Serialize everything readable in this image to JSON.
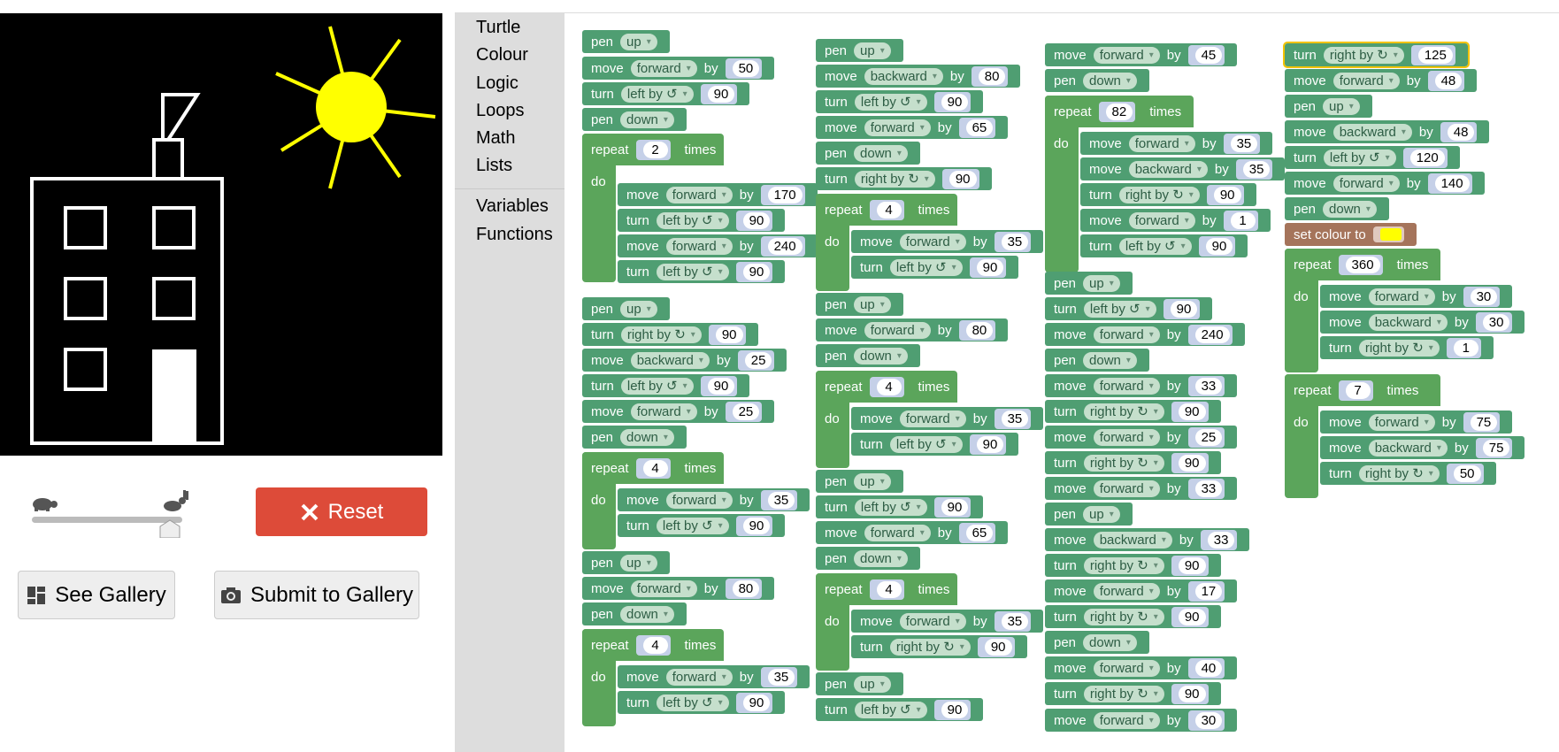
{
  "buttons": {
    "reset": "Reset",
    "see_gallery": "See Gallery",
    "submit_gallery": "Submit to Gallery"
  },
  "toolbox": [
    "Turtle",
    "Colour",
    "Logic",
    "Loops",
    "Math",
    "Lists",
    "Variables",
    "Functions"
  ],
  "blocks": {
    "word_pen": "pen",
    "word_move": "move",
    "word_turn": "turn",
    "word_by": "by",
    "word_repeat": "repeat",
    "word_times": "times",
    "word_do": "do",
    "word_set_colour": "set colour to",
    "opt_up": "up",
    "opt_down": "down",
    "opt_forward": "forward",
    "opt_backward": "backward",
    "opt_left": "left by ↺",
    "opt_right": "right by ↻"
  },
  "values": {
    "c1": [
      "50",
      "90",
      "2",
      "170",
      "90",
      "240",
      "90",
      "90",
      "25",
      "90",
      "25",
      "4",
      "35",
      "90",
      "80",
      "4",
      "35",
      "90"
    ],
    "c2": [
      "80",
      "90",
      "65",
      "90",
      "4",
      "35",
      "90",
      "80",
      "4",
      "35",
      "90",
      "90",
      "65",
      "4",
      "35",
      "90",
      "90"
    ],
    "c3": [
      "45",
      "82",
      "35",
      "35",
      "90",
      "1",
      "90",
      "90",
      "240",
      "33",
      "90",
      "25",
      "90",
      "33",
      "33",
      "90",
      "17",
      "90",
      "40",
      "90",
      "30"
    ],
    "c4": [
      "125",
      "48",
      "48",
      "120",
      "140",
      "360",
      "30",
      "30",
      "1",
      "7",
      "75",
      "75",
      "50"
    ]
  },
  "colours": {
    "pen_colour": "#ffff00",
    "turtle_block": "#4f9e72",
    "control_block": "#5ba55b",
    "colour_block": "#a5745b",
    "reset_button": "#dd4b39"
  },
  "icons": [
    "turtle-icon",
    "hare-icon",
    "close-icon",
    "gallery-icon",
    "camera-icon"
  ]
}
